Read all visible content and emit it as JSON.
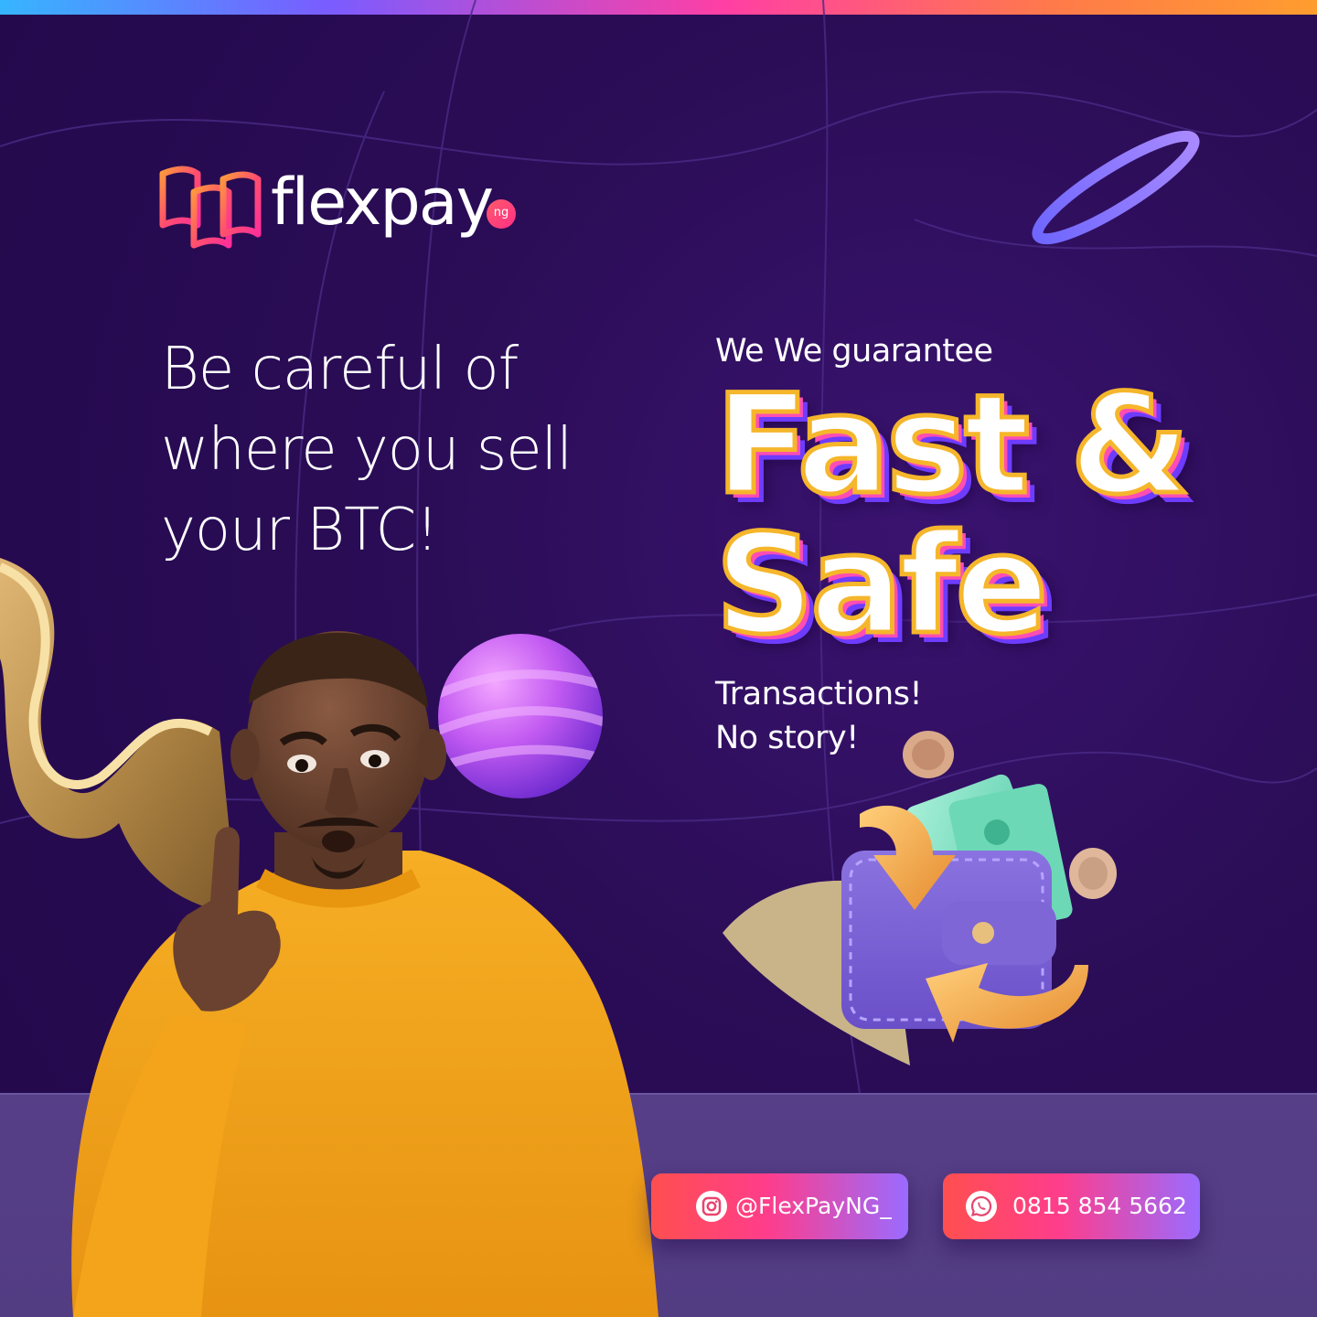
{
  "brand": {
    "name": "flexpay",
    "badge": "ng"
  },
  "headline": {
    "lines": [
      "Be careful of",
      "where you sell",
      "your BTC!"
    ]
  },
  "offer": {
    "intro": "We We guarantee",
    "big_line_1": "Fast &",
    "big_line_2": "Safe",
    "sub_lines": [
      "Transactions!",
      "No story!"
    ]
  },
  "contacts": {
    "instagram": "@FlexPayNG_",
    "whatsapp": "0815 854 5662"
  },
  "colors": {
    "background": "#2b0d57",
    "floor": "#573f88",
    "accent_pink": "#ff3d8b",
    "accent_orange": "#f5b62b",
    "accent_purple": "#6d3cff"
  },
  "icons": [
    "instagram-icon",
    "whatsapp-icon"
  ]
}
